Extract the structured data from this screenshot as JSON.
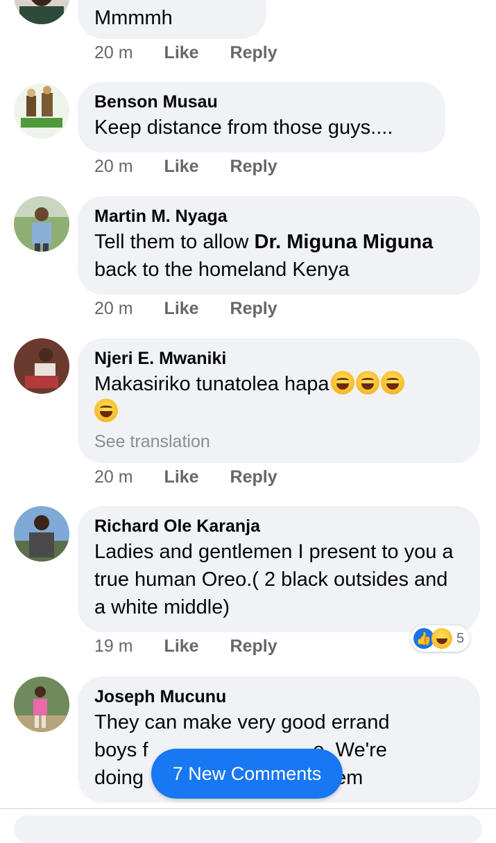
{
  "comments": [
    {
      "author": "",
      "text": "Mmmmh",
      "time": "20 m",
      "like": "Like",
      "reply": "Reply"
    },
    {
      "author": "Benson Musau",
      "text": "Keep distance from those guys....",
      "time": "20 m",
      "like": "Like",
      "reply": "Reply"
    },
    {
      "author": "Martin M. Nyaga",
      "text_pre": "Tell them to allow ",
      "text_bold": "Dr. Miguna Miguna",
      "text_post": " back to the homeland Kenya",
      "time": "20 m",
      "like": "Like",
      "reply": "Reply"
    },
    {
      "author": "Njeri E. Mwaniki",
      "text": "Makasiriko tunatolea hapa",
      "see_translation": "See translation",
      "time": "20 m",
      "like": "Like",
      "reply": "Reply"
    },
    {
      "author": "Richard Ole Karanja",
      "text": "Ladies and gentlemen I present to you a true human Oreo.( 2 black outsides and a white middle)",
      "time": "19 m",
      "like": "Like",
      "reply": "Reply",
      "reaction_count": "5"
    },
    {
      "author": "Joseph Mucunu",
      "text_line1": "They can make very good errand",
      "text_line2_start": "boys f",
      "text_line2_end": "e. We're",
      "text_line3_start": "doing",
      "text_line3_end": "em"
    }
  ],
  "new_comments_label": "7 New Comments",
  "colors": {
    "bubble": "#f0f2f5",
    "accent": "#1877f2",
    "meta": "#65676b"
  }
}
